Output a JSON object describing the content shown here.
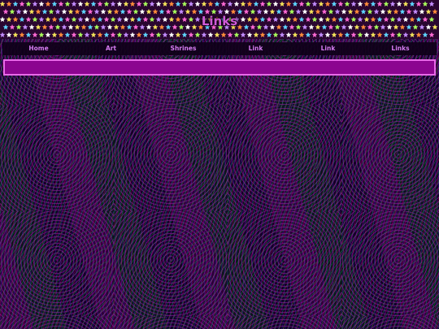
{
  "page": {
    "title": "Links"
  },
  "nav": {
    "items": [
      {
        "label": "Home"
      },
      {
        "label": "Art"
      },
      {
        "label": "Shrines"
      },
      {
        "label": "Link"
      },
      {
        "label": "Link"
      },
      {
        "label": "Links"
      }
    ]
  },
  "content": {
    "bar_text": ""
  },
  "colors": {
    "title": "#d05ad8",
    "nav_text": "#d47cf0",
    "content_bar_fill": "#8c0590",
    "content_bar_border": "#e86ae8",
    "star_colors": [
      "#f4e35a",
      "#ff8c3a",
      "#5ed6ff",
      "#ff6ad5",
      "#a8ff5a",
      "#c38cff",
      "#ffffff"
    ]
  },
  "icons": {
    "banner": "star-icon"
  }
}
